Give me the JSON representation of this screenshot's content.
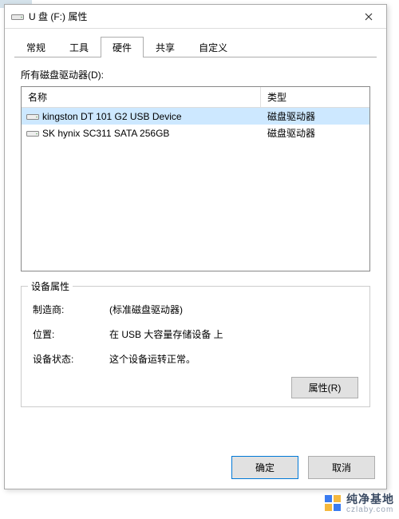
{
  "window": {
    "title": "U 盘 (F:) 属性"
  },
  "tabs": {
    "items": [
      {
        "label": "常规"
      },
      {
        "label": "工具"
      },
      {
        "label": "硬件"
      },
      {
        "label": "共享"
      },
      {
        "label": "自定义"
      }
    ],
    "active_index": 2
  },
  "panel": {
    "all_drives_label": "所有磁盘驱动器(D):",
    "columns": {
      "name": "名称",
      "type": "类型"
    },
    "rows": [
      {
        "name": "kingston DT 101 G2 USB Device",
        "type": "磁盘驱动器",
        "selected": true
      },
      {
        "name": "SK hynix SC311 SATA 256GB",
        "type": "磁盘驱动器",
        "selected": false
      }
    ]
  },
  "device_props": {
    "legend": "设备属性",
    "rows": {
      "manufacturer": {
        "label": "制造商:",
        "value": "(标准磁盘驱动器)"
      },
      "location": {
        "label": "位置:",
        "value": "在 USB 大容量存储设备 上"
      },
      "status": {
        "label": "设备状态:",
        "value": "这个设备运转正常。"
      }
    },
    "properties_button": "属性(R)"
  },
  "dialog": {
    "ok": "确定",
    "cancel": "取消"
  },
  "watermark": {
    "cn": "纯净基地",
    "en": "czlaby.com"
  }
}
